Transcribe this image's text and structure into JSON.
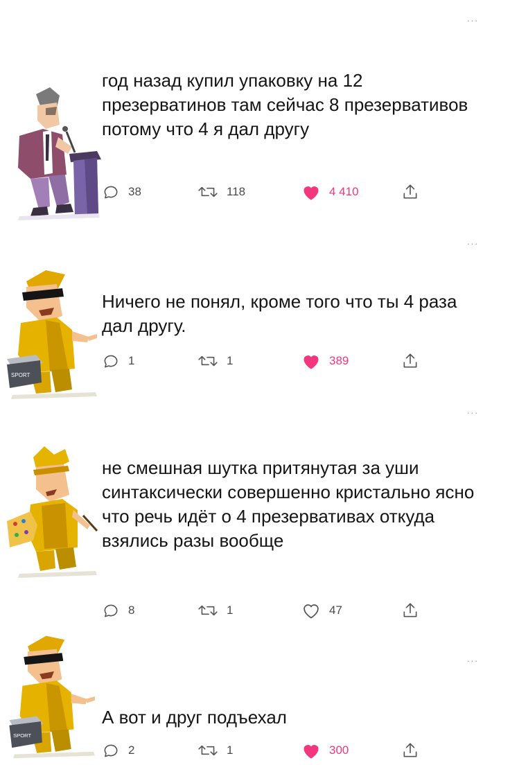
{
  "colors": {
    "like_active": "#f2377f",
    "icon_gray": "#4a4a4a",
    "more_dots": "#a8a8a8"
  },
  "posts": [
    {
      "text": "год назад купил упаковку на 12 презерватинов там сейчас 8 презервативов потому что 4 я дал другу",
      "more": "···",
      "replies": "38",
      "retweets": "118",
      "likes": "4 410",
      "liked": true,
      "avatar": "speaker-at-podium"
    },
    {
      "text": "Ничего не понял, кроме того что ты 4 раза дал другу.",
      "more": "···",
      "replies": "1",
      "retweets": "1",
      "likes": "389",
      "liked": true,
      "avatar": "yellow-man-sunglasses-sport-bag",
      "bag_label": "SPORT"
    },
    {
      "text": "не смешная шутка притянутая за уши синтаксически совершенно кристально ясно что речь идёт о 4 презервативах откуда взялись разы вообще",
      "more": "···",
      "replies": "8",
      "retweets": "1",
      "likes": "47",
      "liked": false,
      "avatar": "yellow-painter-with-palette"
    },
    {
      "text": "А вот и друг подъехал",
      "more": "···",
      "replies": "2",
      "retweets": "1",
      "likes": "300",
      "liked": true,
      "avatar": "yellow-man-sunglasses-sport-bag",
      "bag_label": "SPORT"
    }
  ]
}
